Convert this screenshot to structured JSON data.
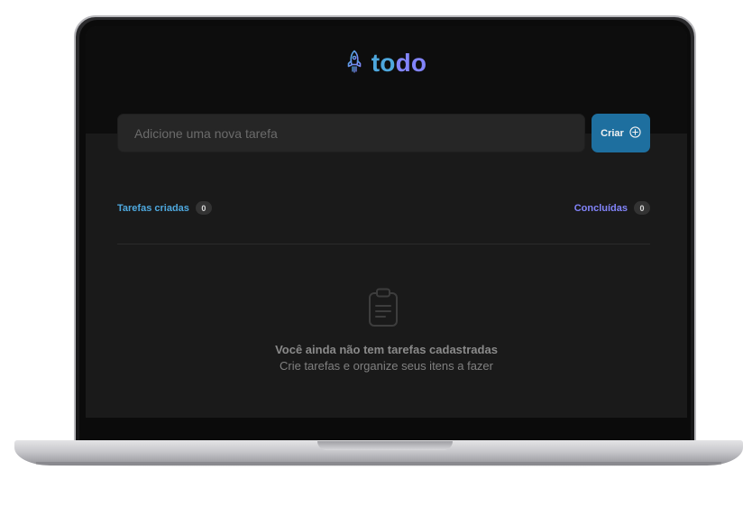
{
  "app": {
    "logo_word_part1": "to",
    "logo_word_part2": "do",
    "logo_icon": "rocket-icon"
  },
  "new_task": {
    "placeholder": "Adicione uma nova tarefa",
    "value": "",
    "create_label": "Criar",
    "create_icon": "plus-circle-icon"
  },
  "counters": {
    "created_label": "Tarefas criadas",
    "created_count": "0",
    "done_label": "Concluídas",
    "done_count": "0"
  },
  "empty_state": {
    "icon": "clipboard-icon",
    "title": "Você ainda não tem tarefas cadastradas",
    "subtitle": "Crie tarefas e organize seus itens a fazer"
  },
  "colors": {
    "blue": "#4ea8de",
    "purple": "#8284fa",
    "button": "#1e6f9f",
    "background": "#1a1a1a",
    "header": "#0d0d0d"
  }
}
